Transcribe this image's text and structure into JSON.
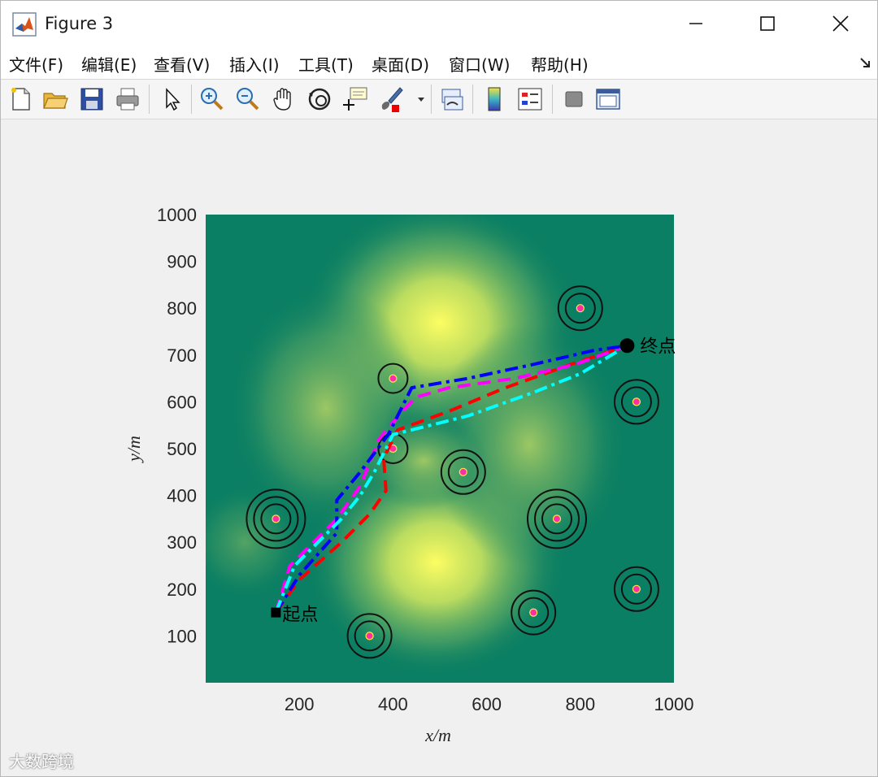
{
  "window": {
    "title": "Figure 3"
  },
  "menu": [
    "文件(F)",
    "编辑(E)",
    "查看(V)",
    "插入(I)",
    "工具(T)",
    "桌面(D)",
    "窗口(W)",
    "帮助(H)"
  ],
  "toolbar": [
    "new-file-icon",
    "open-folder-icon",
    "save-icon",
    "print-icon",
    "pointer-icon",
    "zoom-in-icon",
    "zoom-out-icon",
    "pan-hand-icon",
    "rotate-3d-icon",
    "data-cursor-icon",
    "brush-icon",
    "link-plot-icon",
    "colorbar-icon",
    "legend-icon",
    "hide-plot-tools-icon",
    "show-plot-tools-icon"
  ],
  "watermark": "大数跨境",
  "chart_data": {
    "type": "line",
    "xlabel": "x/m",
    "ylabel": "y/m",
    "xlim": [
      0,
      1000
    ],
    "ylim": [
      0,
      1000
    ],
    "xticks": [
      200,
      400,
      600,
      800,
      1000
    ],
    "yticks": [
      100,
      200,
      300,
      400,
      500,
      600,
      700,
      800,
      900,
      1000
    ],
    "background": "terrain heatmap (summer colormap, peaks near (500,780), (420,520), (720,500), (510,240))",
    "start": {
      "label": "起点",
      "x": 150,
      "y": 150
    },
    "end": {
      "label": "终点",
      "x": 900,
      "y": 720
    },
    "obstacles": [
      {
        "x": 150,
        "y": 350,
        "rings": 3
      },
      {
        "x": 350,
        "y": 100,
        "rings": 2
      },
      {
        "x": 400,
        "y": 650,
        "rings": 1
      },
      {
        "x": 400,
        "y": 500,
        "rings": 1
      },
      {
        "x": 550,
        "y": 450,
        "rings": 2
      },
      {
        "x": 700,
        "y": 150,
        "rings": 2
      },
      {
        "x": 750,
        "y": 350,
        "rings": 3
      },
      {
        "x": 800,
        "y": 800,
        "rings": 2
      },
      {
        "x": 920,
        "y": 600,
        "rings": 2
      },
      {
        "x": 920,
        "y": 200,
        "rings": 2
      }
    ],
    "series": [
      {
        "color": "#ff0000",
        "dash": "dashed",
        "x": [
          150,
          200,
          290,
          350,
          385,
          380,
          410,
          520,
          640,
          780,
          900
        ],
        "y": [
          150,
          220,
          300,
          360,
          410,
          480,
          540,
          580,
          630,
          680,
          720
        ]
      },
      {
        "color": "#ff00ff",
        "dash": "dashed",
        "x": [
          150,
          180,
          280,
          330,
          370,
          420,
          450,
          520,
          660,
          790,
          900
        ],
        "y": [
          150,
          250,
          350,
          420,
          520,
          580,
          610,
          630,
          650,
          680,
          720
        ]
      },
      {
        "color": "#0000ff",
        "dash": "dashdot",
        "x": [
          150,
          200,
          280,
          280,
          330,
          390,
          440,
          560,
          700,
          830,
          900
        ],
        "y": [
          150,
          230,
          320,
          390,
          450,
          530,
          630,
          650,
          680,
          710,
          720
        ]
      },
      {
        "color": "#00ffff",
        "dash": "dashdot",
        "x": [
          150,
          190,
          290,
          330,
          360,
          400,
          560,
          700,
          800,
          900
        ],
        "y": [
          150,
          250,
          350,
          400,
          450,
          530,
          570,
          620,
          660,
          720
        ]
      }
    ]
  }
}
